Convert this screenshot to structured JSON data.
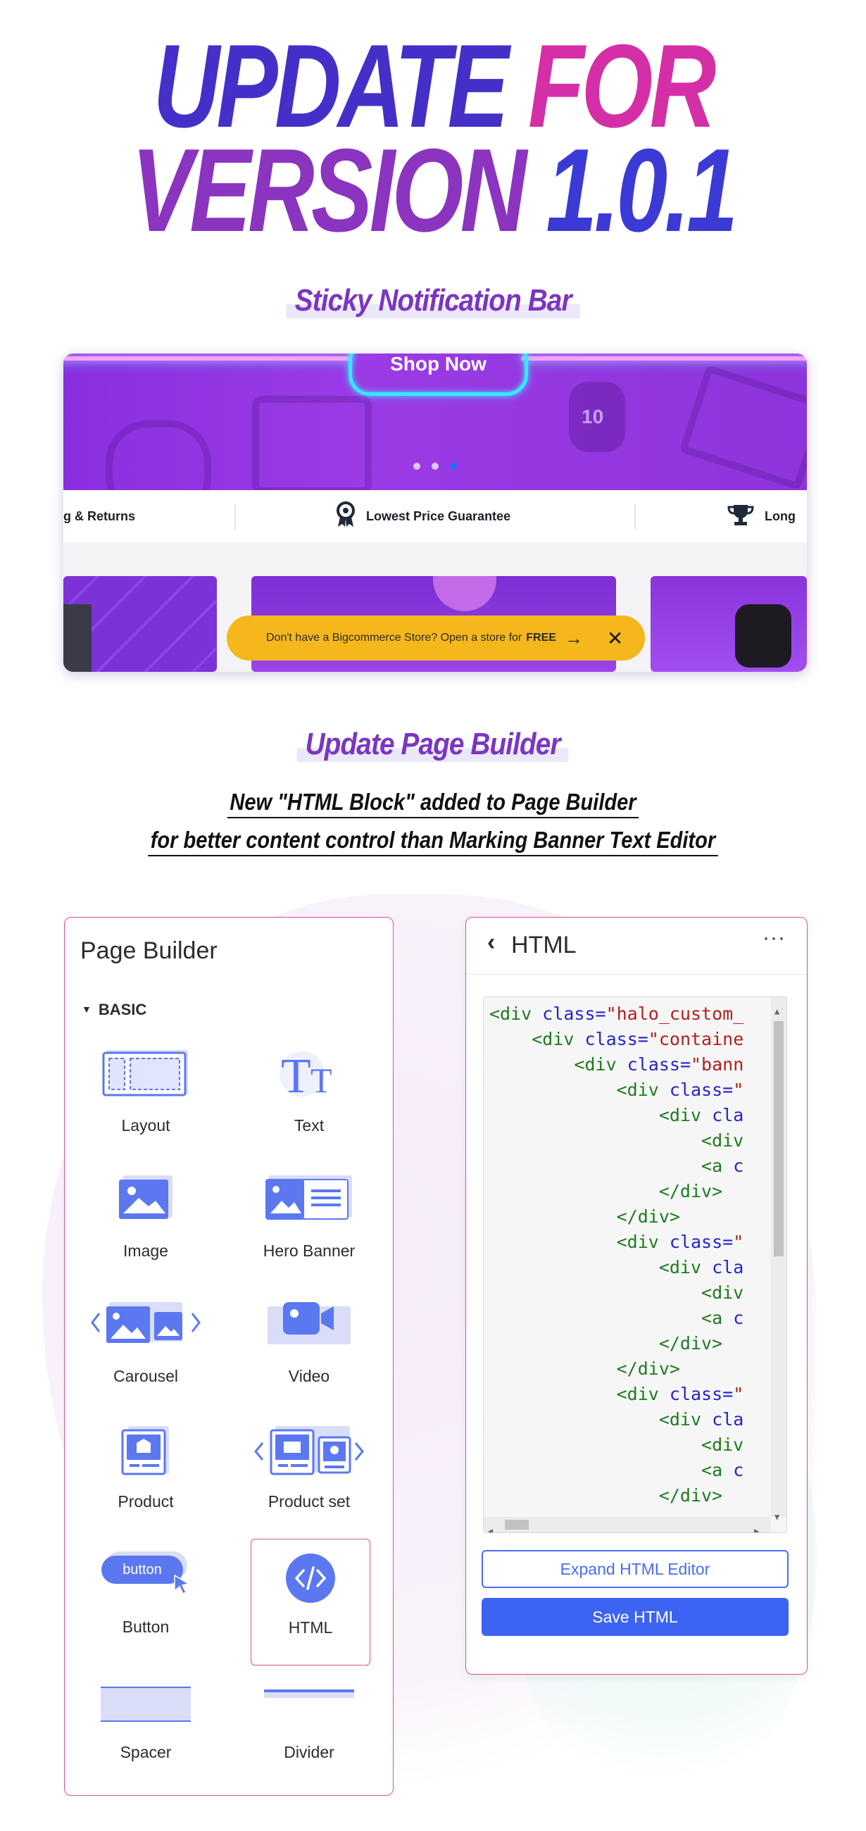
{
  "title": {
    "line1_word1": "UPDATE",
    "line1_word2": "FOR",
    "line2_word1": "VERSION",
    "line2_word2": "1.0.1"
  },
  "section1": {
    "heading": "Sticky Notification Bar",
    "hero": {
      "cta_label": "Shop Now",
      "watch_text": "10"
    },
    "features": [
      {
        "label": "g & Returns"
      },
      {
        "label": "Lowest Price Guarantee",
        "icon": "award-ribbon-icon"
      },
      {
        "label": "Long",
        "icon": "trophy-icon"
      }
    ],
    "notification": {
      "text": "Don't have a Bigcommerce Store?  Open a store for",
      "emphasis": "FREE",
      "arrow": "→",
      "close": "✕"
    }
  },
  "section2": {
    "heading": "Update Page Builder",
    "caption_line1": "New \"HTML Block\" added to Page Builder ",
    "caption_line2": "for better content control than Marking Banner Text Editor"
  },
  "page_builder": {
    "title": "Page Builder",
    "group": "BASIC",
    "items": [
      {
        "label": "Layout",
        "icon": "layout-icon"
      },
      {
        "label": "Text",
        "icon": "text-icon"
      },
      {
        "label": "Image",
        "icon": "image-icon"
      },
      {
        "label": "Hero Banner",
        "icon": "hero-banner-icon"
      },
      {
        "label": "Carousel",
        "icon": "carousel-icon"
      },
      {
        "label": "Video",
        "icon": "video-icon"
      },
      {
        "label": "Product",
        "icon": "product-icon"
      },
      {
        "label": "Product set",
        "icon": "product-set-icon"
      },
      {
        "label": "Button",
        "icon": "button-icon",
        "icon_text": "button"
      },
      {
        "label": "HTML",
        "icon": "html-code-icon",
        "selected": true
      },
      {
        "label": "Spacer",
        "icon": "spacer-icon"
      },
      {
        "label": "Divider",
        "icon": "divider-icon"
      }
    ]
  },
  "html_panel": {
    "back": "‹",
    "title": "HTML",
    "more": "···",
    "code_lines": [
      "<div class=\"halo_custom_",
      "    <div class=\"containe",
      "        <div class=\"bann",
      "            <div class=\"",
      "                <div cla",
      "                    <div",
      "                    <a c",
      "                </div>",
      "            </div>",
      "            <div class=\"",
      "                <div cla",
      "                    <div",
      "                    <a c",
      "                </div>",
      "            </div>",
      "            <div class=\"",
      "                <div cla",
      "                    <div",
      "                    <a c",
      "                </div>"
    ],
    "expand_label": "Expand HTML Editor",
    "save_label": "Save HTML"
  },
  "colors": {
    "accent_blue": "#3d63f2",
    "panel_border": "#d7528d",
    "notif_yellow": "#f6b71c",
    "hero_purple": "#8a2fe0"
  }
}
